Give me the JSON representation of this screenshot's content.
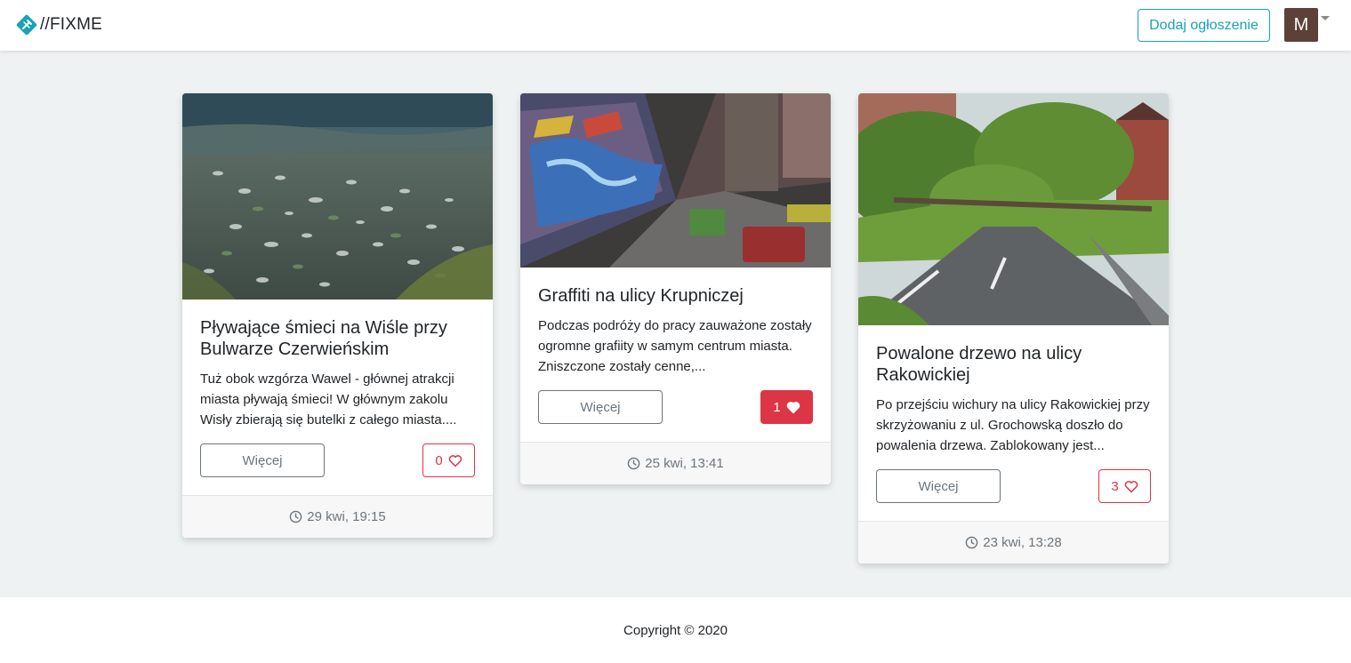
{
  "nav": {
    "brand": "//FIXME",
    "add_label": "Dodaj ogłoszenie",
    "avatar_initial": "M",
    "brand_color": "#17a2b8"
  },
  "cards": [
    {
      "title": "Pływające śmieci na Wiśle przy Bulwarze Czerwieńskim",
      "text": "Tuż obok wzgórza Wawel - głównej atrakcji miasta pływają śmieci! W głównym zakolu Wisły zbierają się butelki z całego miasta....",
      "more_label": "Więcej",
      "likes": "0",
      "liked": false,
      "date": "29 kwi, 19:15",
      "image": "river-with-plastic-bottles-photo"
    },
    {
      "title": "Graffiti na ulicy Krupniczej",
      "text": "Podczas podróży do pracy zauważone zostały ogromne grafiity w samym centrum miasta. Zniszczone zostały cenne,...",
      "more_label": "Więcej",
      "likes": "1",
      "liked": true,
      "date": "25 kwi, 13:41",
      "image": "graffiti-alley-photo"
    },
    {
      "title": "Powalone drzewo na ulicy Rakowickiej",
      "text": "Po przejściu wichury na ulicy Rakowickiej przy skrzyżowaniu z ul. Grochowską doszło do powalenia drzewa. Zablokowany jest...",
      "more_label": "Więcej",
      "likes": "3",
      "liked": false,
      "date": "23 kwi, 13:28",
      "image": "fallen-tree-on-street-photo"
    }
  ],
  "footer": {
    "copyright": "Copyright © 2020"
  },
  "colors": {
    "accent": "#17a2b8",
    "like": "#dc3545",
    "background": "#eef2f2",
    "avatar": "#5d4037"
  }
}
